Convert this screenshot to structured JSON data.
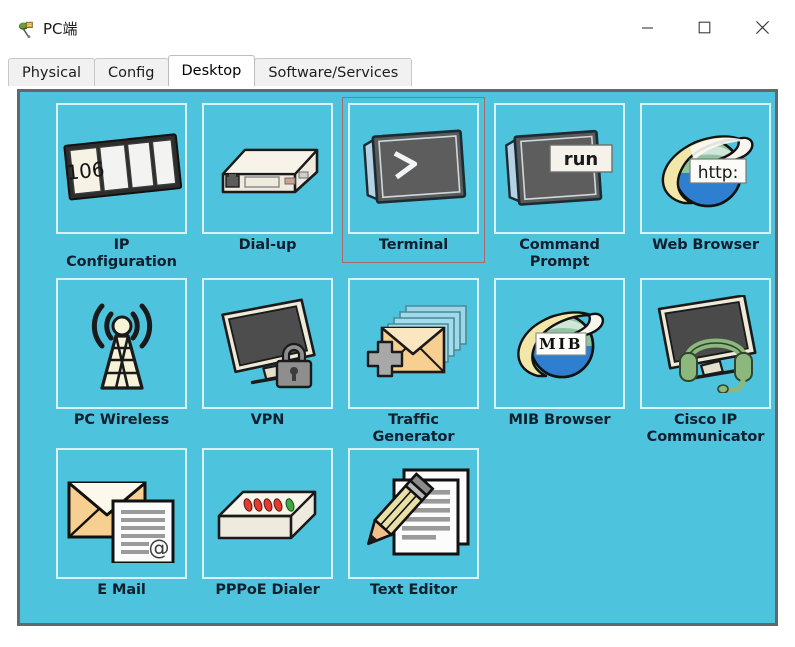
{
  "window": {
    "title": "PC端",
    "app_icon": "packet-tracer-pc-icon",
    "controls": {
      "minimize_label": "—",
      "maximize_label": "□",
      "close_label": "✕"
    }
  },
  "tabs": [
    {
      "label": "Physical",
      "active": false
    },
    {
      "label": "Config",
      "active": false
    },
    {
      "label": "Desktop",
      "active": true
    },
    {
      "label": "Software/Services",
      "active": false
    }
  ],
  "colors": {
    "panel_background": "#4ec3dd",
    "panel_border": "#62686c",
    "tile_border": "#d8f2f7",
    "selection_border": "#a86a6a",
    "label_text": "#0f1f2e",
    "active_tab_background": "#ffffff",
    "inactive_tab_background": "#f1f1f1"
  },
  "desktop": {
    "items": [
      {
        "label": "IP\nConfiguration",
        "icon": "ip-configuration-icon",
        "selected": false,
        "badge_text": "106"
      },
      {
        "label": "Dial-up",
        "icon": "dial-up-icon",
        "selected": false
      },
      {
        "label": "Terminal",
        "icon": "terminal-icon",
        "selected": true,
        "badge_text": ">"
      },
      {
        "label": "Command\nPrompt",
        "icon": "command-prompt-icon",
        "selected": false,
        "badge_text": "run"
      },
      {
        "label": "Web Browser",
        "icon": "web-browser-icon",
        "selected": false,
        "badge_text": "http:"
      },
      {
        "label": "PC Wireless",
        "icon": "pc-wireless-icon",
        "selected": false
      },
      {
        "label": "VPN",
        "icon": "vpn-icon",
        "selected": false
      },
      {
        "label": "Traffic\nGenerator",
        "icon": "traffic-generator-icon",
        "selected": false
      },
      {
        "label": "MIB Browser",
        "icon": "mib-browser-icon",
        "selected": false,
        "badge_text": "MIB"
      },
      {
        "label": "Cisco IP\nCommunicator",
        "icon": "cisco-ip-communicator-icon",
        "selected": false
      },
      {
        "label": "E Mail",
        "icon": "email-icon",
        "selected": false,
        "badge_text": "@"
      },
      {
        "label": "PPPoE Dialer",
        "icon": "pppoe-dialer-icon",
        "selected": false
      },
      {
        "label": "Text Editor",
        "icon": "text-editor-icon",
        "selected": false
      }
    ]
  }
}
